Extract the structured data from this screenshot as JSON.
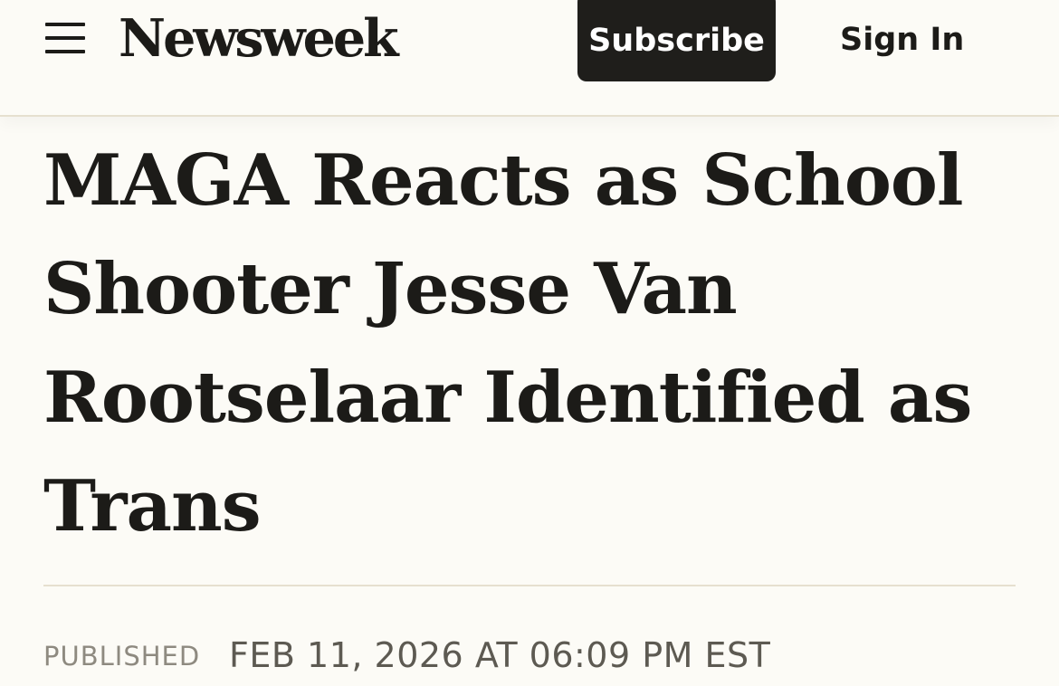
{
  "header": {
    "menu_icon": "hamburger-menu-icon",
    "logo": "Newsweek",
    "subscribe_label": "Subscribe",
    "signin_label": "Sign In"
  },
  "article": {
    "headline": "MAGA Reacts as School Shooter Jesse Van Rootselaar Identified as Trans",
    "published_label": "PUBLISHED",
    "published_date": "FEB 11, 2026 AT 06:09 PM EST"
  },
  "colors": {
    "background": "#fcfbf6",
    "text": "#1c1b18",
    "subscribe_bg": "#1f1e1b",
    "divider": "#e6e0cf",
    "muted": "#8e8a80"
  }
}
